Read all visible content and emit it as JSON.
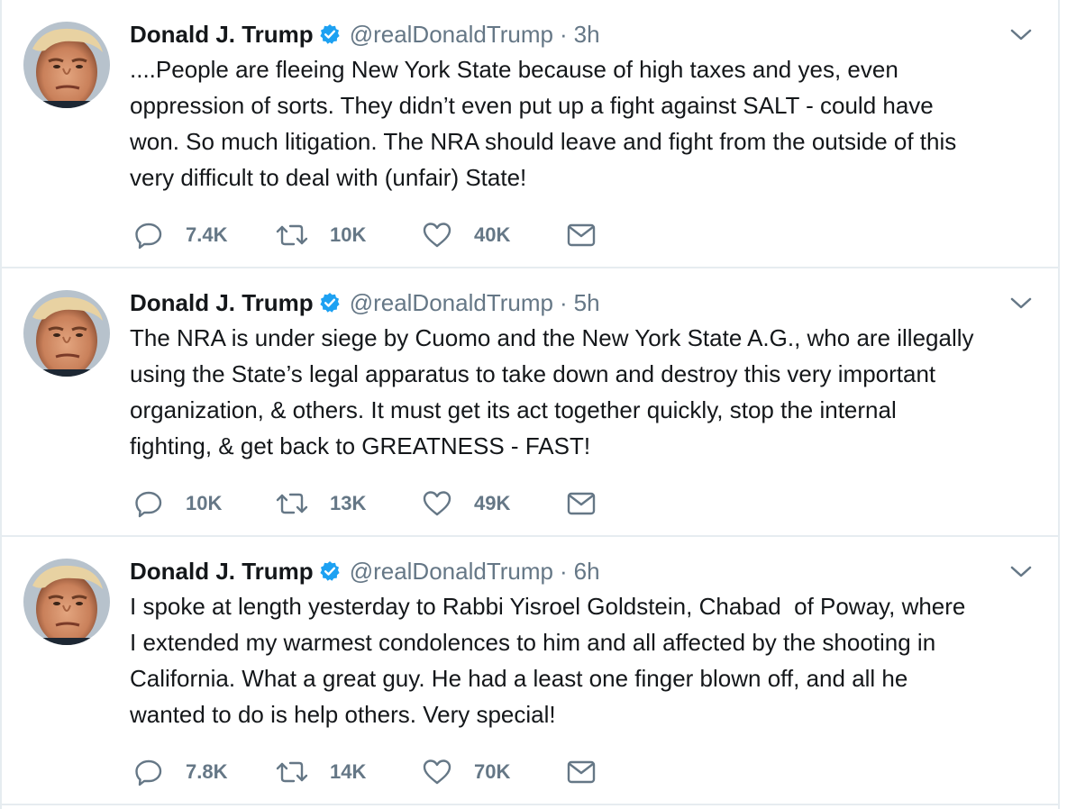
{
  "colors": {
    "text": "#14171a",
    "muted": "#657786",
    "verified": "#1da1f2",
    "divider": "#e6ecf0"
  },
  "icons": {
    "avatar": "profile-photo",
    "verified": "verified-badge-icon",
    "menu": "chevron-down-icon",
    "reply": "reply-icon",
    "retweet": "retweet-icon",
    "like": "heart-icon",
    "dm": "envelope-icon"
  },
  "tweets": [
    {
      "name": "Donald J. Trump",
      "handle": "@realDonaldTrump",
      "separator": "·",
      "time": "3h",
      "text": "....People are fleeing New York State because of high taxes and yes, even\noppression of sorts. They didn’t even put up a fight against SALT - could have\nwon. So much litigation. The NRA should leave and fight from the outside of this\nvery difficult to deal with (unfair) State!",
      "replies": "7.4K",
      "retweets": "10K",
      "likes": "40K"
    },
    {
      "name": "Donald J. Trump",
      "handle": "@realDonaldTrump",
      "separator": "·",
      "time": "5h",
      "text": "The NRA is under siege by Cuomo and the New York State A.G., who are illegally\nusing the State’s legal apparatus to take down and destroy this very important\norganization, & others. It must get its act together quickly, stop the internal\nfighting, & get back to GREATNESS - FAST!",
      "replies": "10K",
      "retweets": "13K",
      "likes": "49K"
    },
    {
      "name": "Donald J. Trump",
      "handle": "@realDonaldTrump",
      "separator": "·",
      "time": "6h",
      "text": "I spoke at length yesterday to Rabbi Yisroel Goldstein, Chabad  of Poway, where\nI extended my warmest condolences to him and all affected by the shooting in\nCalifornia. What a great guy. He had a least one finger blown off, and all he\nwanted to do is help others. Very special!",
      "replies": "7.8K",
      "retweets": "14K",
      "likes": "70K"
    }
  ]
}
